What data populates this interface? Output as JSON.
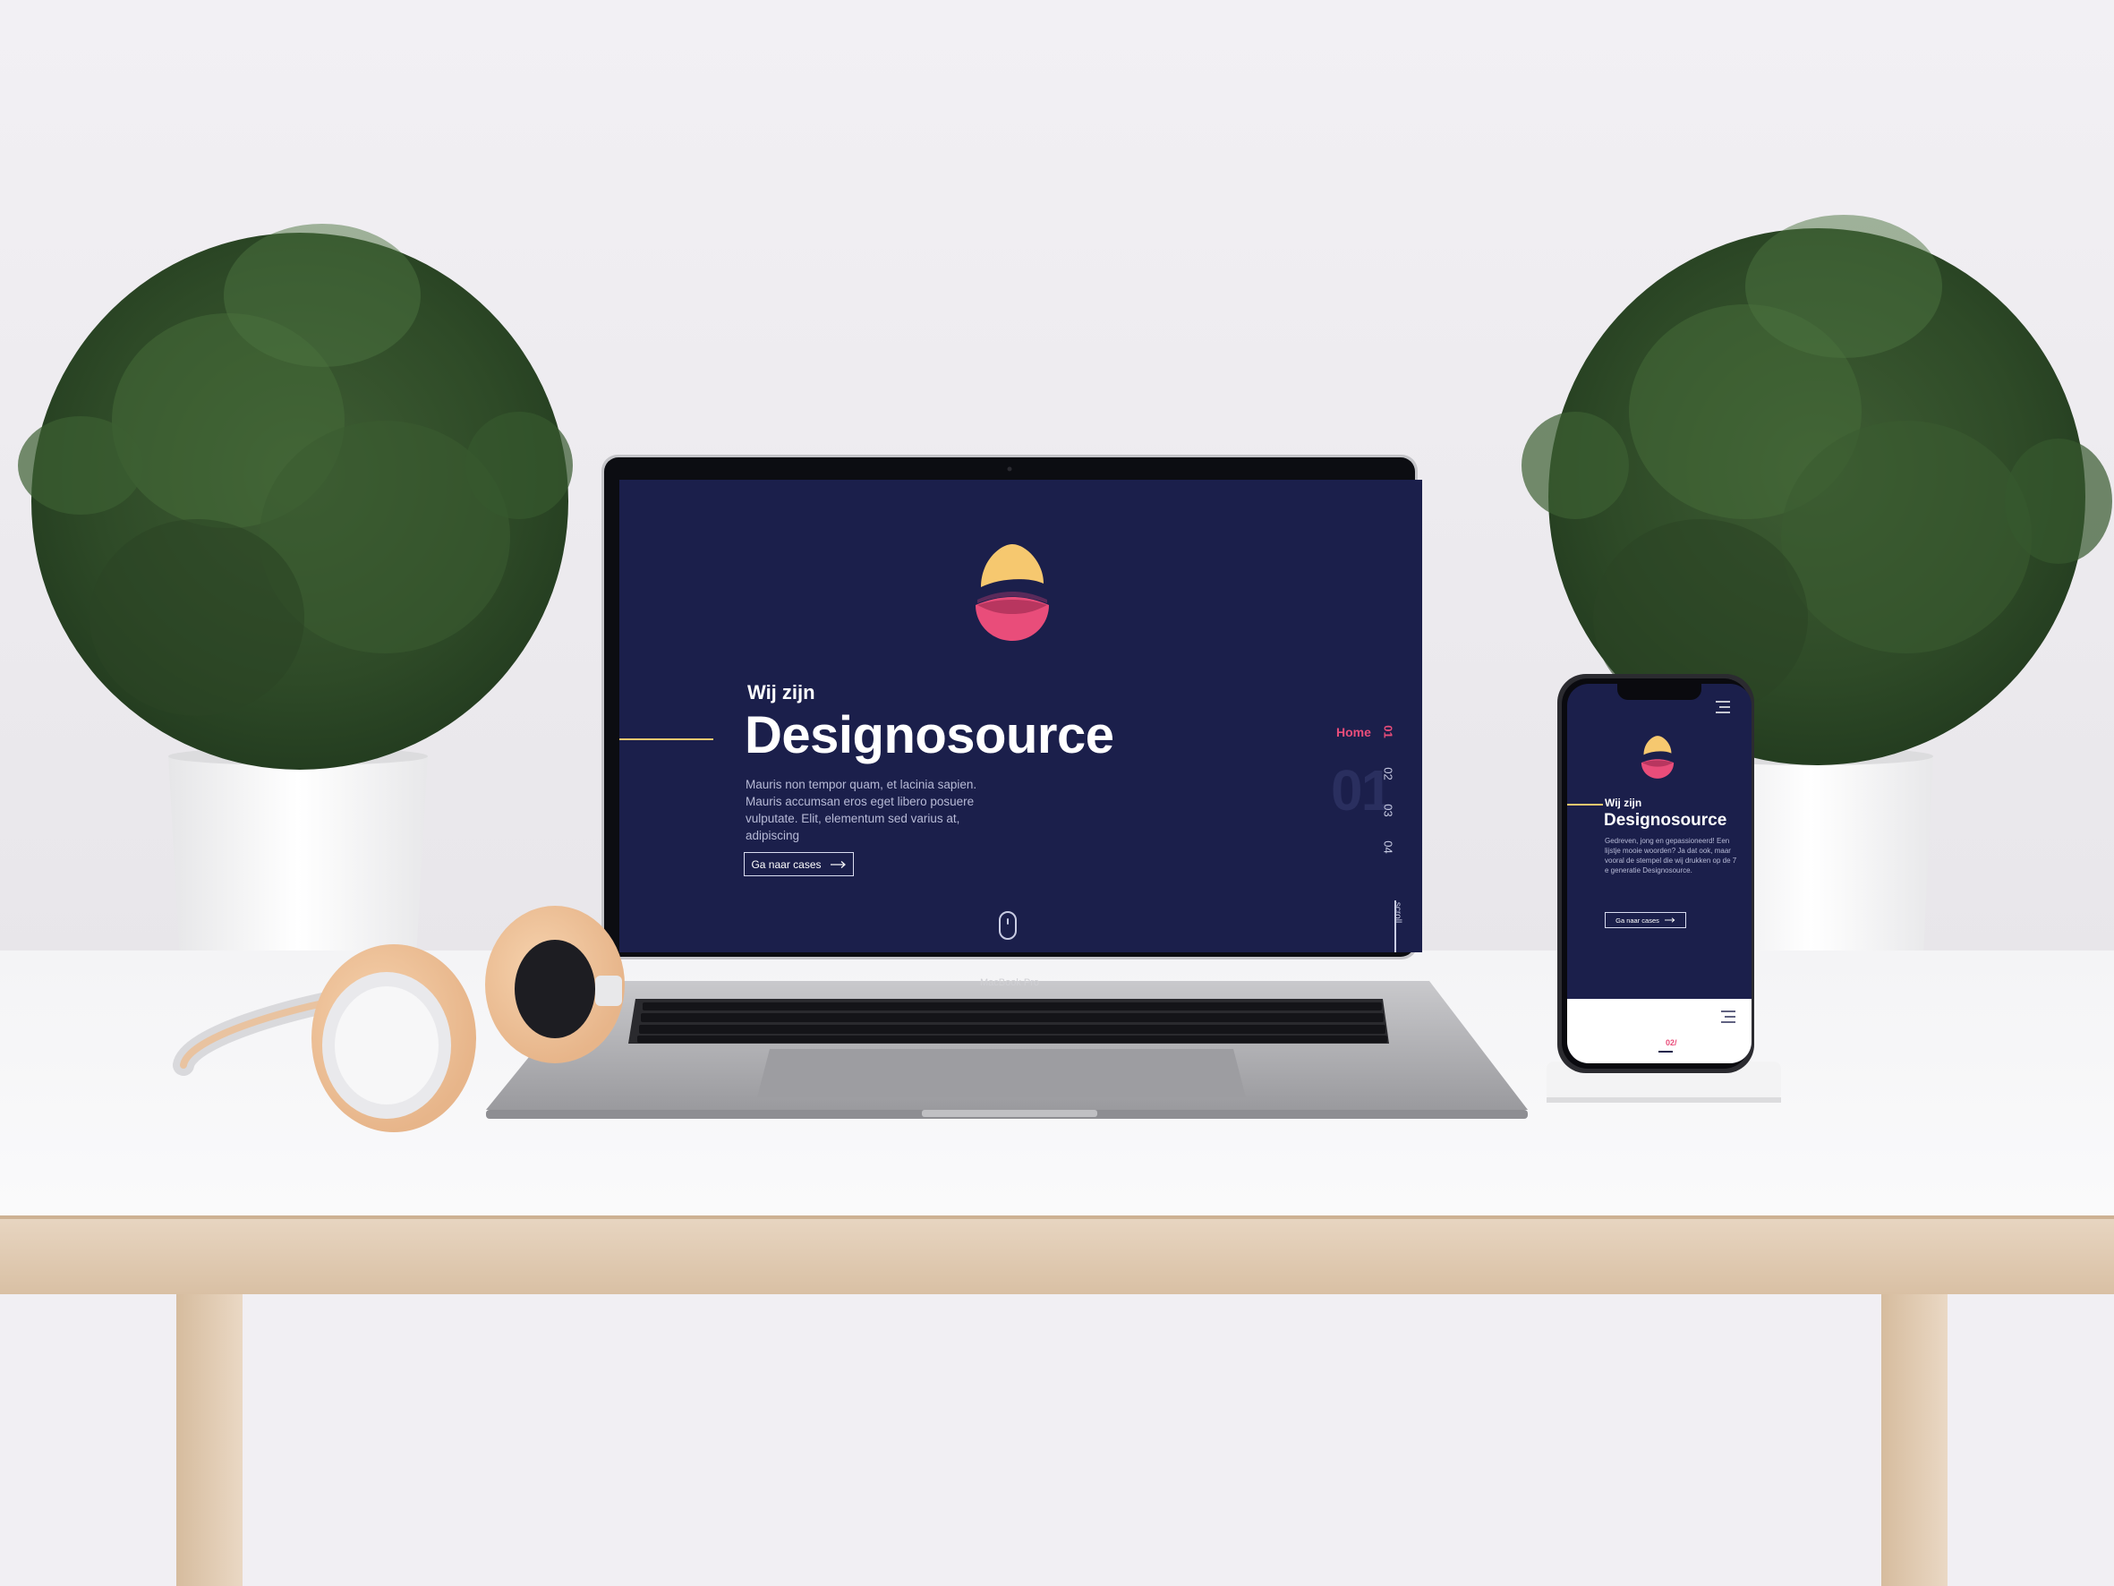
{
  "laptop": {
    "brand_label": "MacBook Pro",
    "screen": {
      "intro": "Wij zijn",
      "title": "Designosource",
      "description": "Mauris non tempor quam, et lacinia sapien. Mauris accumsan eros eget libero posuere vulputate. Elit, elementum sed varius at, adipiscing",
      "cta_label": "Ga naar cases",
      "nav": {
        "active_label": "Home",
        "items": [
          "01",
          "02",
          "03",
          "04"
        ],
        "big_number": "01",
        "scroll_label": "scroll"
      }
    }
  },
  "phone": {
    "screen": {
      "intro": "Wij zijn",
      "title": "Designosource",
      "description": "Gedreven, jong en gepassioneerd! Een lijstje mooie woorden? Ja dat ook, maar vooral de stempel die wij drukken op de 7 e generatie Designosource.",
      "cta_label": "Ga naar cases",
      "page_counter": "02/"
    }
  },
  "colors": {
    "screen_bg": "#1b1f4b",
    "accent_pink": "#e94d7a",
    "accent_yellow": "#f6c86f",
    "text_muted": "#b7bad6"
  },
  "icons": [
    "logo-icon",
    "arrow-right-icon",
    "mouse-scroll-icon",
    "hamburger-menu-icon"
  ]
}
